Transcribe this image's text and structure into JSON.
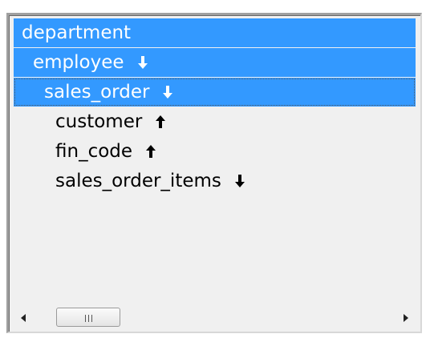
{
  "tree": {
    "items": [
      {
        "label": "department",
        "level": 0,
        "selected": true,
        "focused": false,
        "arrow": ""
      },
      {
        "label": "employee",
        "level": 1,
        "selected": true,
        "focused": false,
        "arrow": "down"
      },
      {
        "label": "sales_order",
        "level": 2,
        "selected": true,
        "focused": true,
        "arrow": "down"
      },
      {
        "label": "customer",
        "level": 3,
        "selected": false,
        "focused": false,
        "arrow": "up"
      },
      {
        "label": "fin_code",
        "level": 3,
        "selected": false,
        "focused": false,
        "arrow": "up"
      },
      {
        "label": "sales_order_items",
        "level": 3,
        "selected": false,
        "focused": false,
        "arrow": "down"
      }
    ]
  },
  "colors": {
    "selection": "#3399ff",
    "selected_text": "#ffffff",
    "text": "#000000",
    "panel_background": "#f0f0f0"
  },
  "scrollbar": {
    "orientation": "horizontal",
    "left_icon": "chevron-left-icon",
    "right_icon": "chevron-right-icon",
    "thumb_icon": "grip-icon"
  }
}
